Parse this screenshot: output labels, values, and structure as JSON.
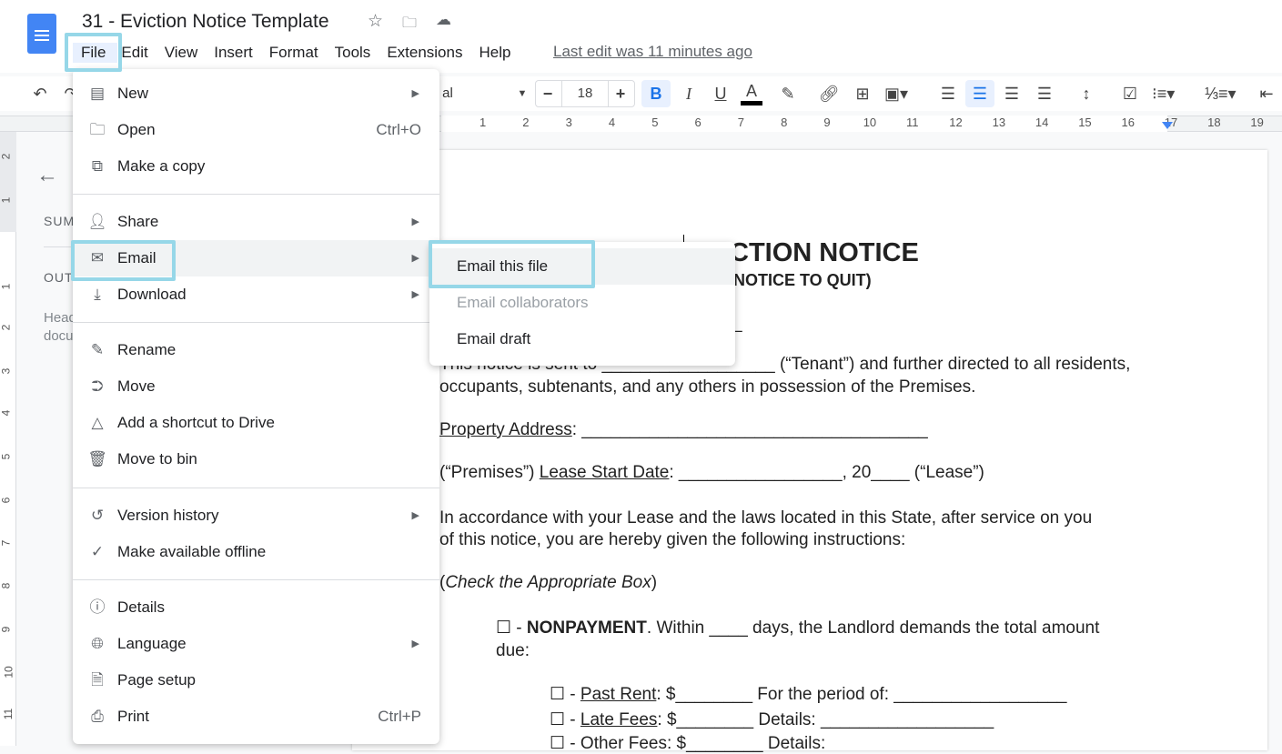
{
  "title": "31 - Eviction Notice Template",
  "menubar": [
    "File",
    "Edit",
    "View",
    "Insert",
    "Format",
    "Tools",
    "Extensions",
    "Help"
  ],
  "last_edit": "Last edit was 11 minutes ago",
  "toolbar": {
    "font": "al",
    "font_size": "18"
  },
  "ruler_numbers": [
    "1",
    "2",
    "3",
    "4",
    "5",
    "6",
    "7",
    "8",
    "9",
    "10",
    "11",
    "12",
    "13",
    "14",
    "15",
    "16",
    "17",
    "18",
    "19"
  ],
  "vruler_numbers": [
    "2",
    "1",
    "1",
    "2",
    "3",
    "4",
    "5",
    "6",
    "7",
    "8",
    "9",
    "10",
    "11"
  ],
  "outline": {
    "summary": "SUM",
    "outline": "OUT",
    "hint1": "Head",
    "hint2": "docu"
  },
  "file_menu": [
    {
      "icon": "new-doc-icon",
      "label": "New",
      "arrow": true
    },
    {
      "icon": "folder-icon",
      "label": "Open",
      "shortcut": "Ctrl+O"
    },
    {
      "icon": "copy-icon",
      "label": "Make a copy"
    },
    {
      "icon": "share-icon",
      "label": "Share",
      "arrow": true
    },
    {
      "icon": "email-icon",
      "label": "Email",
      "arrow": true
    },
    {
      "icon": "download-icon",
      "label": "Download",
      "arrow": true
    },
    {
      "icon": "rename-icon",
      "label": "Rename"
    },
    {
      "icon": "move-icon",
      "label": "Move"
    },
    {
      "icon": "drive-shortcut-icon",
      "label": "Add a shortcut to Drive"
    },
    {
      "icon": "trash-icon",
      "label": "Move to bin"
    },
    {
      "icon": "history-icon",
      "label": "Version history",
      "arrow": true
    },
    {
      "icon": "offline-icon",
      "label": "Make available offline"
    },
    {
      "icon": "info-icon",
      "label": "Details"
    },
    {
      "icon": "globe-icon",
      "label": "Language",
      "arrow": true
    },
    {
      "icon": "page-setup-icon",
      "label": "Page setup"
    },
    {
      "icon": "print-icon",
      "label": "Print",
      "shortcut": "Ctrl+P"
    }
  ],
  "email_submenu": [
    {
      "label": "Email this file"
    },
    {
      "label": "Email collaborators",
      "disabled": true
    },
    {
      "label": "Email draft"
    }
  ],
  "document": {
    "heading": "CTION NOTICE",
    "subheading": "NOTICE TO QUIT)",
    "blank_line": "_",
    "p1a": "This notice is sent to __________________ (“Tenant”) and further directed to all residents,",
    "p1b": "occupants, subtenants, and any others in possession of the Premises.",
    "prop_label": "Property Address",
    "prop_rest": ": ____________________________________",
    "lease_a": "(“Premises”) ",
    "lease_label": "Lease Start Date",
    "lease_rest": ": _________________, 20____ (“Lease”)",
    "p2a": "In accordance with your Lease and the laws located in this State, after service on you",
    "p2b": "of this notice, you are hereby given the following instructions:",
    "check_open": "(",
    "check_italic": "Check the Appropriate Box",
    "check_close": ")",
    "np_box": "☐ - ",
    "np_bold": "NONPAYMENT",
    "np_rest": ". Within ____ days, the Landlord demands the total amount",
    "np_due": "due:",
    "past_box": "☐ - ",
    "past_label": "Past Rent",
    "past_rest": ": $________ For the period of: __________________",
    "late_box": "☐ - ",
    "late_label": "Late Fees",
    "late_rest": ": $________ Details: __________________",
    "other": "☐ - Other Fees: $________ Details: "
  },
  "highlight_color": "#96d7e8"
}
